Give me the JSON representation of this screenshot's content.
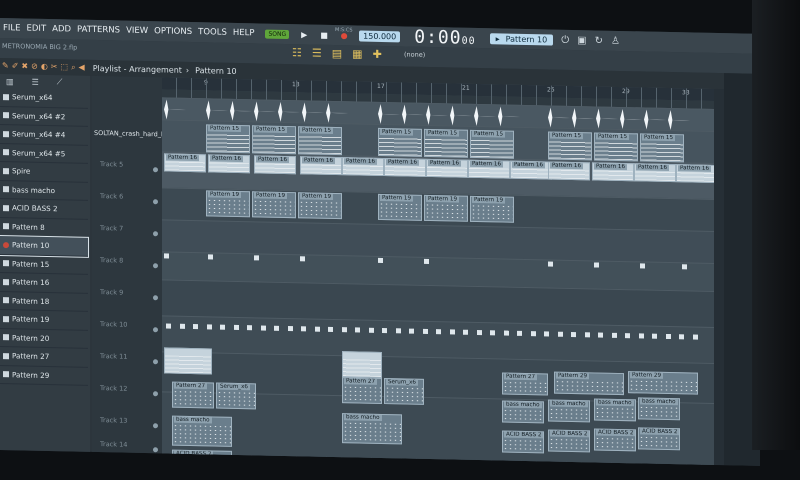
{
  "menubar": {
    "items": [
      "FILE",
      "EDIT",
      "ADD",
      "PATTERNS",
      "VIEW",
      "OPTIONS",
      "TOOLS",
      "HELP"
    ],
    "song_label": "SONG",
    "tempo": "150.000",
    "time_main": "0:00",
    "time_small": "00",
    "time_unit": "M:S:CS",
    "pattern_selector": "Pattern 10"
  },
  "subbar": {
    "project_name": "METRONOMIA BIG 2.flp",
    "pattern_none": "(none)"
  },
  "playlist": {
    "title": "Playlist - Arrangement",
    "current_pattern": "Pattern 10"
  },
  "browser": {
    "items": [
      {
        "label": "Serum_x64",
        "glyph": "plugin"
      },
      {
        "label": "Serum_x64 #2",
        "glyph": "plugin"
      },
      {
        "label": "Serum_x64 #4",
        "glyph": "plugin"
      },
      {
        "label": "Serum_x64 #5",
        "glyph": "plugin"
      },
      {
        "label": "Spire",
        "glyph": "plugin"
      },
      {
        "label": "bass macho",
        "glyph": "plugin"
      },
      {
        "label": "ACID BASS 2",
        "glyph": "plugin"
      },
      {
        "label": "Pattern 8",
        "glyph": "pattern"
      },
      {
        "label": "Pattern 10",
        "glyph": "pattern",
        "selected": true
      },
      {
        "label": "Pattern 15",
        "glyph": "pattern"
      },
      {
        "label": "Pattern 16",
        "glyph": "pattern"
      },
      {
        "label": "Pattern 18",
        "glyph": "pattern"
      },
      {
        "label": "Pattern 19",
        "glyph": "pattern"
      },
      {
        "label": "Pattern 20",
        "glyph": "pattern"
      },
      {
        "label": "Pattern 27",
        "glyph": "pattern"
      },
      {
        "label": "Pattern 29",
        "glyph": "pattern"
      }
    ]
  },
  "tracks": {
    "instrument_head": "SOLTAN_crash_hard_hit",
    "names": [
      "Track 5",
      "Track 6",
      "Track 7",
      "Track 8",
      "Track 9",
      "Track 10",
      "Track 11",
      "Track 12",
      "Track 13",
      "Track 14"
    ]
  },
  "ruler_numbers": [
    "9",
    "13",
    "17",
    "21",
    "25",
    "29",
    "33"
  ],
  "clip_labels": {
    "p15": "Pattern 15",
    "p16": "Pattern 16",
    "p19": "Pattern 19",
    "p27": "Pattern 27",
    "p29": "Pattern 29",
    "serum": "Serum_x6",
    "bass": "bass macho",
    "acid": "ACID BASS 2"
  },
  "colors": {
    "tempo_bg": "#b9d9ee",
    "song_toggle": "#5fa63a",
    "record": "#e04a3a"
  }
}
